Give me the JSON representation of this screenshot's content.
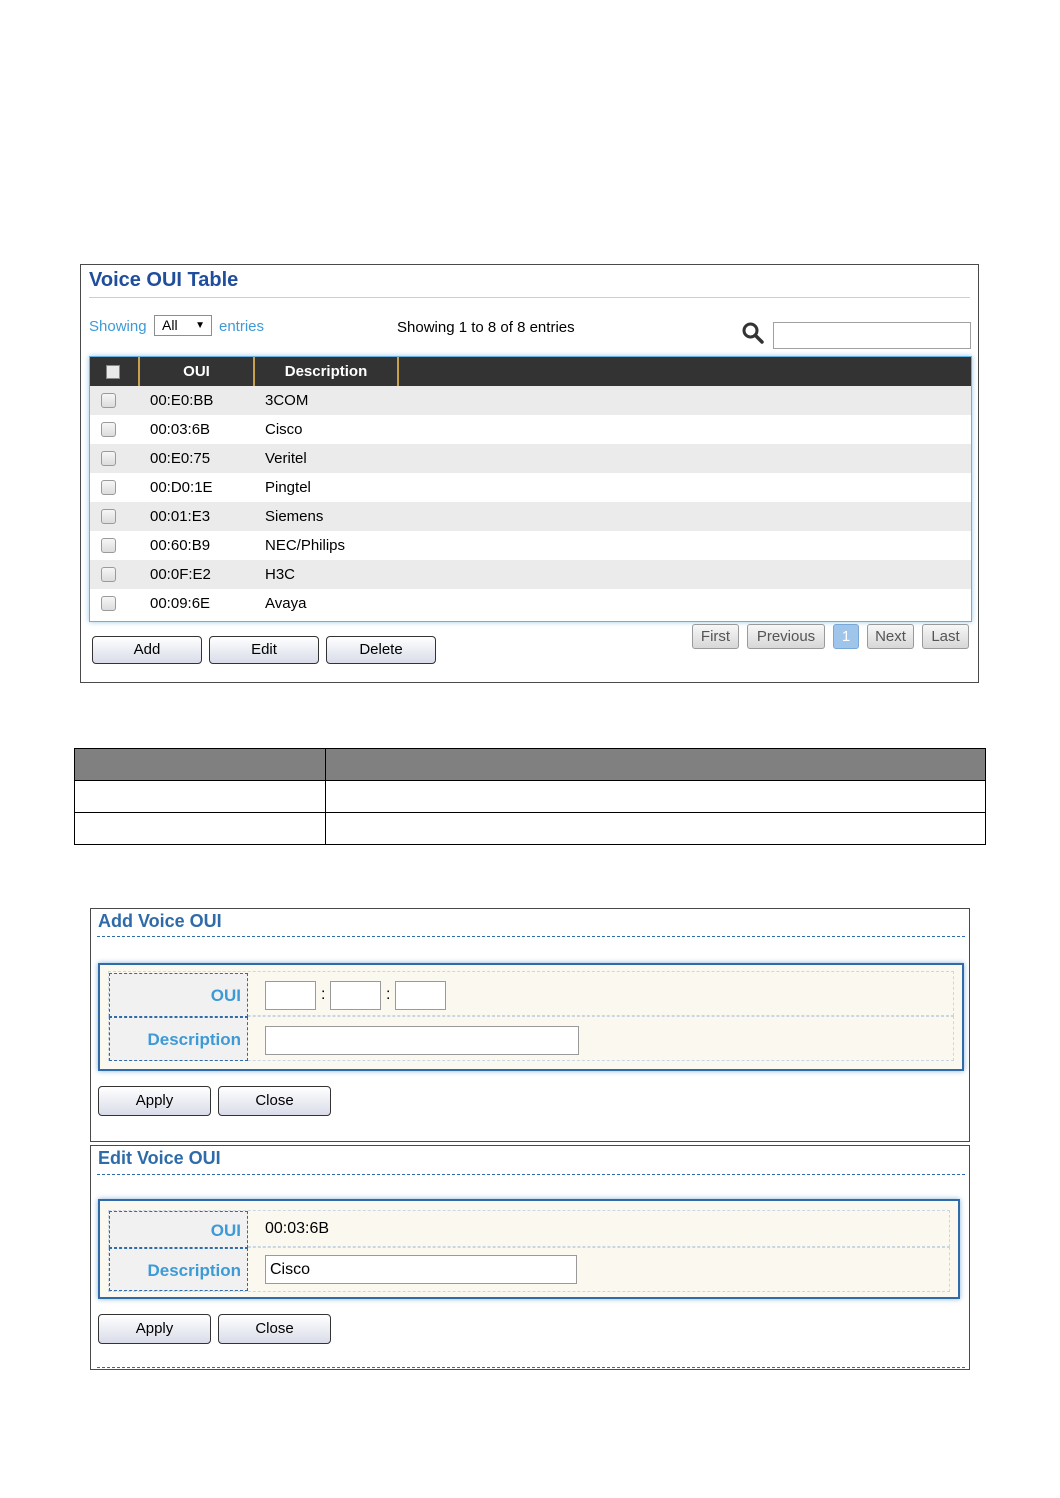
{
  "voice_oui_table": {
    "title": "Voice OUI Table",
    "showing_label": "Showing",
    "entries_select_value": "All",
    "entries_label": "entries",
    "info": "Showing 1 to 8 of 8 entries",
    "search_placeholder": "",
    "columns": [
      "OUI",
      "Description"
    ],
    "rows": [
      {
        "oui": "00:E0:BB",
        "description": "3COM"
      },
      {
        "oui": "00:03:6B",
        "description": "Cisco"
      },
      {
        "oui": "00:E0:75",
        "description": "Veritel"
      },
      {
        "oui": "00:D0:1E",
        "description": "Pingtel"
      },
      {
        "oui": "00:01:E3",
        "description": "Siemens"
      },
      {
        "oui": "00:60:B9",
        "description": "NEC/Philips"
      },
      {
        "oui": "00:0F:E2",
        "description": "H3C"
      },
      {
        "oui": "00:09:6E",
        "description": "Avaya"
      }
    ],
    "buttons": {
      "add": "Add",
      "edit": "Edit",
      "delete": "Delete"
    },
    "pagination": {
      "first": "First",
      "previous": "Previous",
      "current_page": "1",
      "next": "Next",
      "last": "Last"
    }
  },
  "add_voice_oui": {
    "title": "Add Voice OUI",
    "oui_label": "OUI",
    "oui_separator": ":",
    "oui_part1": "",
    "oui_part2": "",
    "oui_part3": "",
    "description_label": "Description",
    "description_value": "",
    "apply": "Apply",
    "close": "Close"
  },
  "edit_voice_oui": {
    "title": "Edit Voice OUI",
    "oui_label": "OUI",
    "oui_value": "00:03:6B",
    "description_label": "Description",
    "description_value": "Cisco",
    "apply": "Apply",
    "close": "Close"
  },
  "colors": {
    "title_blue": "#1f4e9c",
    "label_blue": "#3d9ad6",
    "header_dark": "#333333",
    "active_page": "#9fc5ea"
  }
}
